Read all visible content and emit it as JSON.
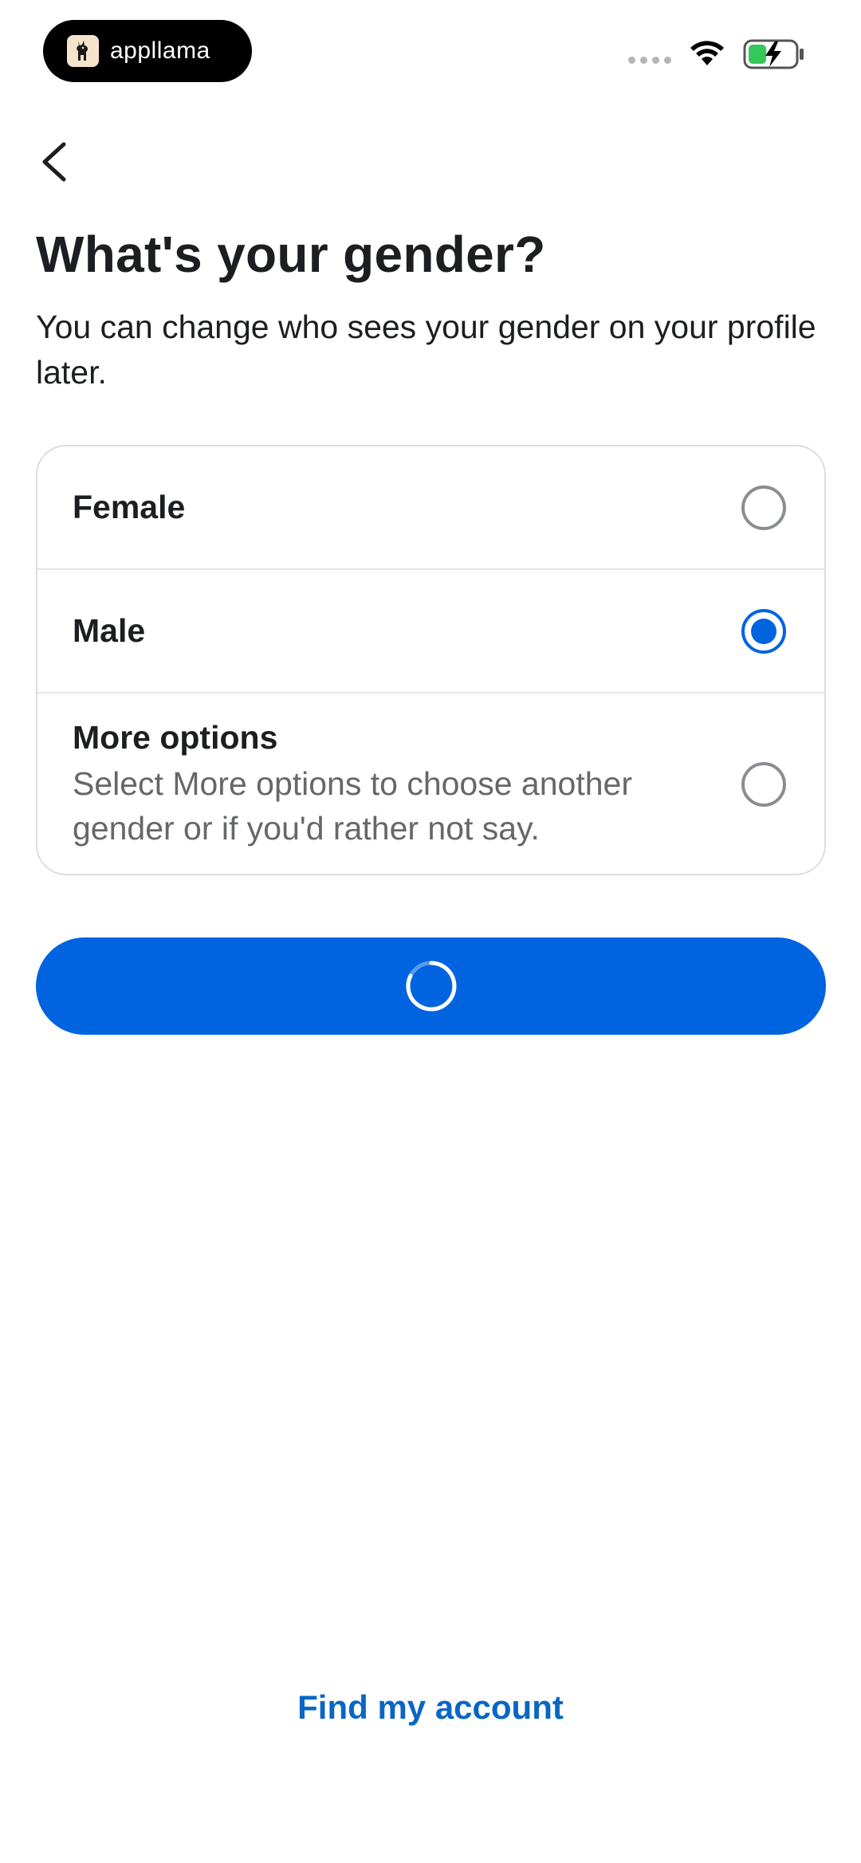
{
  "status_bar": {
    "app_name": "appllama",
    "icons": [
      "signal-dots-icon",
      "wifi-icon",
      "battery-charging-icon"
    ],
    "battery_color": "#34c759"
  },
  "header": {
    "back_icon": "chevron-left-icon"
  },
  "page": {
    "title": "What's your gender?",
    "subtitle": "You can change who sees your gender on your profile later."
  },
  "options": [
    {
      "label": "Female",
      "selected": false
    },
    {
      "label": "Male",
      "selected": true
    },
    {
      "label": "More options",
      "description": "Select More options to choose another gender or if you'd rather not say.",
      "selected": false
    }
  ],
  "primary_button": {
    "state": "loading",
    "icon": "spinner-icon"
  },
  "footer": {
    "link_label": "Find my account"
  },
  "colors": {
    "accent": "#0064e0",
    "link": "#0a66c2",
    "text_primary": "#1c1e21",
    "text_secondary": "#65676b"
  }
}
